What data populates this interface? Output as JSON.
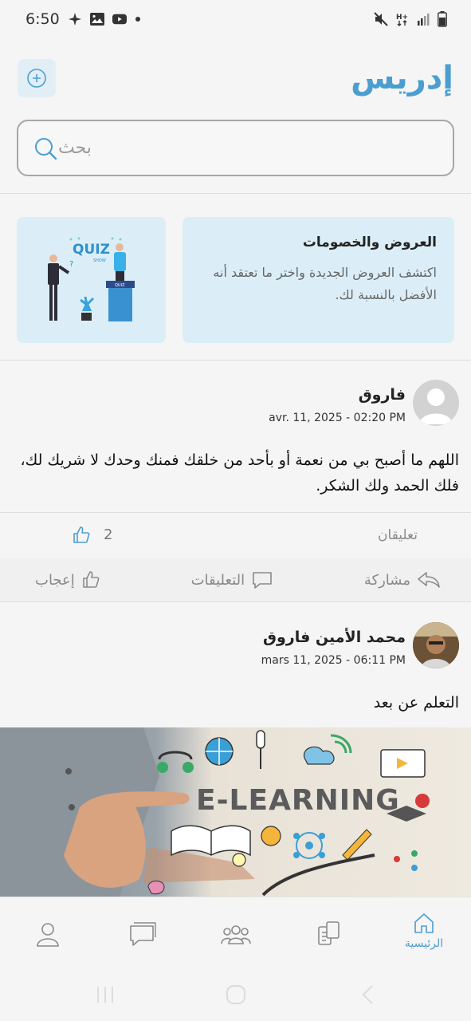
{
  "status_bar": {
    "time": "6:50",
    "left_icons": [
      "sparkle-icon",
      "image-icon",
      "youtube-icon",
      "dot-icon"
    ],
    "right_icons": [
      "mute-icon",
      "network-icon",
      "signal-icon",
      "battery-icon"
    ]
  },
  "header": {
    "title": "إدريس",
    "add_icon": "plus-circle-icon"
  },
  "search": {
    "placeholder": "بحث",
    "icon": "search-icon"
  },
  "promo": {
    "title": "العروض والخصومات",
    "text": "اكتشف العروض الجديدة واختر ما تعتقد أنه الأفضل بالنسبة لك.",
    "quiz_label": "QUIZ",
    "quiz_sub": "SHOW"
  },
  "posts": [
    {
      "author": "فاروق",
      "date": "avr. 11, 2025 - 02:20 PM",
      "text": "اللهم ما أصبح بي من نعمة أو بأحد من خلقك فمنك وحدك لا شريك لك، فلك الحمد ولك الشكر.",
      "comments_label": "تعليقان",
      "likes": "2"
    },
    {
      "author": "محمد الأمين فاروق",
      "date": "mars 11, 2025 - 06:11 PM",
      "text": "التعلم عن بعد",
      "image_text": "E-LEARNING"
    }
  ],
  "actions": {
    "share": "مشاركة",
    "comments": "التعليقات",
    "like": "إعجاب"
  },
  "bottom_nav": {
    "items": [
      {
        "label": "الرئيسية",
        "icon": "home-icon",
        "active": true
      },
      {
        "label": "",
        "icon": "documents-icon",
        "active": false
      },
      {
        "label": "",
        "icon": "groups-icon",
        "active": false
      },
      {
        "label": "",
        "icon": "chat-icon",
        "active": false
      },
      {
        "label": "",
        "icon": "profile-icon",
        "active": false
      }
    ]
  },
  "colors": {
    "accent": "#4a9ed0",
    "promo_bg": "#dbeef7",
    "background": "#f5f5f5"
  }
}
